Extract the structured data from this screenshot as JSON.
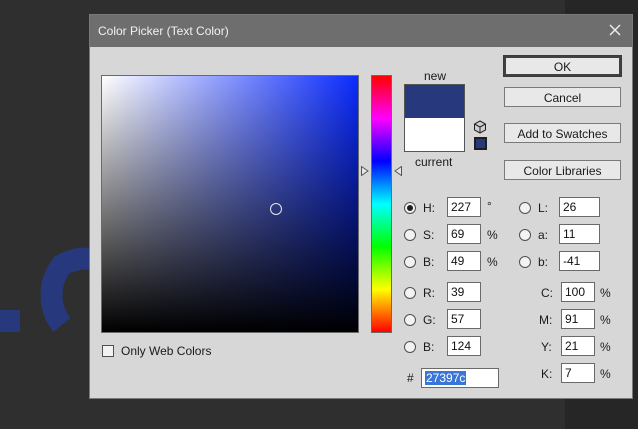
{
  "dialog": {
    "title": "Color Picker (Text Color)",
    "new_label": "new",
    "current_label": "current",
    "new_color": "#27397c",
    "current_color": "#ffffff",
    "only_web_colors_label": "Only Web Colors",
    "only_web_colors_checked": false
  },
  "buttons": {
    "ok": "OK",
    "cancel": "Cancel",
    "add_to_swatches": "Add to Swatches",
    "color_libraries": "Color Libraries"
  },
  "hsb": {
    "h": {
      "label": "H:",
      "value": "227",
      "unit": "°",
      "selected": true
    },
    "s": {
      "label": "S:",
      "value": "69",
      "unit": "%",
      "selected": false
    },
    "b": {
      "label": "B:",
      "value": "49",
      "unit": "%",
      "selected": false
    }
  },
  "rgb": {
    "r": {
      "label": "R:",
      "value": "39"
    },
    "g": {
      "label": "G:",
      "value": "57"
    },
    "b": {
      "label": "B:",
      "value": "124"
    }
  },
  "lab": {
    "l": {
      "label": "L:",
      "value": "26"
    },
    "a": {
      "label": "a:",
      "value": "11"
    },
    "b": {
      "label": "b:",
      "value": "-41"
    }
  },
  "cmyk": {
    "c": {
      "label": "C:",
      "value": "100",
      "unit": "%"
    },
    "m": {
      "label": "M:",
      "value": "91",
      "unit": "%"
    },
    "y": {
      "label": "Y:",
      "value": "21",
      "unit": "%"
    },
    "k": {
      "label": "K:",
      "value": "7",
      "unit": "%"
    }
  },
  "hex": {
    "label": "#",
    "value": "27397c"
  },
  "colors": {
    "accent_selection": "#3a76d8",
    "title_bar": "#6e6e6e",
    "dialog_bg": "#d7d7d7"
  },
  "icons": {
    "close": "close-icon",
    "gamut": "cube-icon",
    "websafe": "websafe-swatch-icon"
  }
}
